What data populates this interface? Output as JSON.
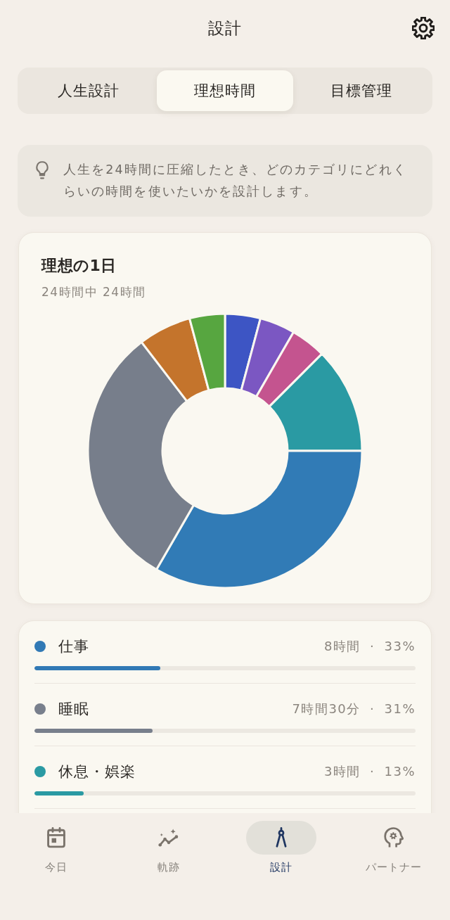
{
  "header": {
    "title": "設計"
  },
  "tabs": [
    {
      "label": "人生設計",
      "selected": false
    },
    {
      "label": "理想時間",
      "selected": true
    },
    {
      "label": "目標管理",
      "selected": false
    }
  ],
  "info": {
    "text": "人生を24時間に圧縮したとき、どのカテゴリにどれくらいの時間を使いたいかを設計します。"
  },
  "chart_card": {
    "title": "理想の1日",
    "subtitle": "24時間中 24時間"
  },
  "categories": [
    {
      "name": "仕事",
      "color": "#3179b5",
      "reading": "8時間 · 33%",
      "level": 0.33
    },
    {
      "name": "睡眠",
      "color": "#787f8c",
      "reading": "7時間30分 · 31%",
      "level": 0.31
    },
    {
      "name": "休息・娯楽",
      "color": "#2a9aa3",
      "reading": "3時間 · 13%",
      "level": 0.13
    }
  ],
  "bottom_nav": [
    {
      "label": "今日",
      "selected": false
    },
    {
      "label": "軌跡",
      "selected": false
    },
    {
      "label": "設計",
      "selected": true
    },
    {
      "label": "パートナー",
      "selected": false
    }
  ]
}
